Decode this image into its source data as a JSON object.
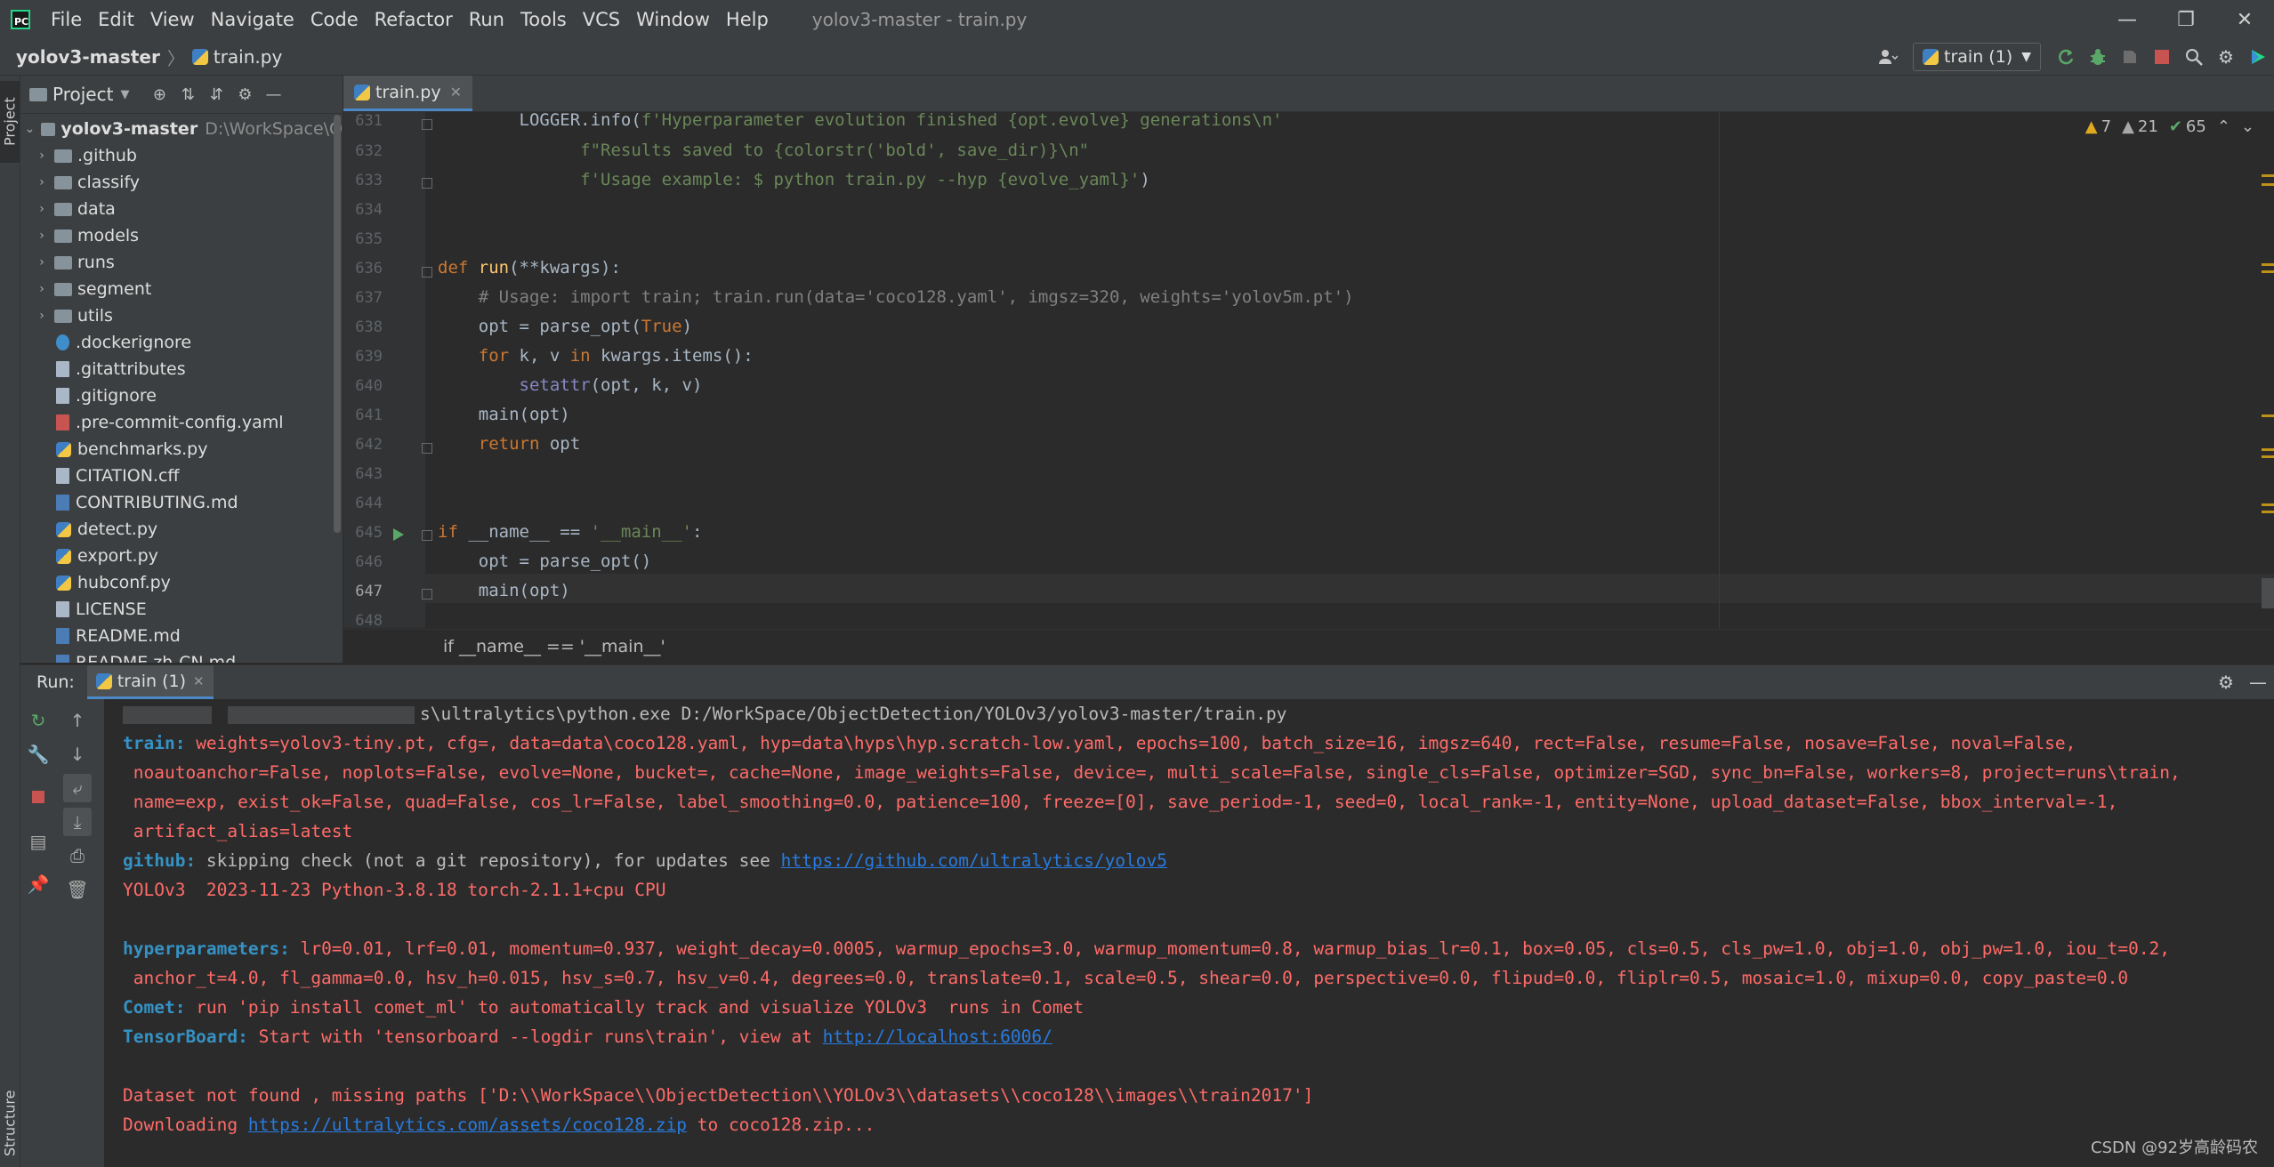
{
  "window": {
    "logo_text": "PC",
    "menu": [
      "File",
      "Edit",
      "View",
      "Navigate",
      "Code",
      "Refactor",
      "Run",
      "Tools",
      "VCS",
      "Window",
      "Help"
    ],
    "title": "yolov3-master - train.py",
    "controls": {
      "minimize": "—",
      "restore": "❐",
      "close": "✕"
    }
  },
  "navbar": {
    "project": "yolov3-master",
    "file": "train.py",
    "run_config": "train (1)"
  },
  "left_strip": {
    "project_tab": "Project",
    "structure_tab": "Structure"
  },
  "project_panel": {
    "title": "Project",
    "root": {
      "name": "yolov3-master",
      "path": "D:\\WorkSpace\\O"
    },
    "folders": [
      ".github",
      "classify",
      "data",
      "models",
      "runs",
      "segment",
      "utils"
    ],
    "files": [
      {
        "name": ".dockerignore",
        "kind": "docker"
      },
      {
        "name": ".gitattributes",
        "kind": "text"
      },
      {
        "name": ".gitignore",
        "kind": "text"
      },
      {
        "name": ".pre-commit-config.yaml",
        "kind": "yaml"
      },
      {
        "name": "benchmarks.py",
        "kind": "py"
      },
      {
        "name": "CITATION.cff",
        "kind": "text"
      },
      {
        "name": "CONTRIBUTING.md",
        "kind": "md"
      },
      {
        "name": "detect.py",
        "kind": "py"
      },
      {
        "name": "export.py",
        "kind": "py"
      },
      {
        "name": "hubconf.py",
        "kind": "py"
      },
      {
        "name": "LICENSE",
        "kind": "text"
      },
      {
        "name": "README.md",
        "kind": "md"
      },
      {
        "name": "README.zh-CN.md",
        "kind": "md"
      }
    ]
  },
  "editor": {
    "tab": "train.py",
    "inspections": {
      "warnings": "7",
      "weak_warnings": "21",
      "ok": "65"
    },
    "line_numbers": [
      "631",
      "632",
      "633",
      "634",
      "635",
      "636",
      "637",
      "638",
      "639",
      "640",
      "641",
      "642",
      "643",
      "644",
      "645",
      "646",
      "647",
      "648"
    ],
    "current_line": "647",
    "code": {
      "l631_a": "LOGGER.info(",
      "l631_b": "f'Hyperparameter evolution finished {opt.evolve} generations\\n'",
      "l632": "f\"Results saved to {colorstr('bold', save_dir)}\\n\"",
      "l633_a": "f'Usage example: $ python train.py --hyp {evolve_yaml}'",
      "l633_b": ")",
      "l636_kw": "def ",
      "l636_fn": "run",
      "l636_rest": "(**kwargs):",
      "l637": "# Usage: import train; train.run(data='coco128.yaml', imgsz=320, weights='yolov5m.pt')",
      "l638_a": "opt = parse_opt(",
      "l638_b": "True",
      "l638_c": ")",
      "l639_a": "for ",
      "l639_b": "k, v ",
      "l639_c": "in ",
      "l639_d": "kwargs.items():",
      "l640_a": "setattr",
      "l640_b": "(opt, k, v)",
      "l641": "main(opt)",
      "l642_a": "return ",
      "l642_b": "opt",
      "l645_a": "if ",
      "l645_b": "__name__",
      "l645_c": " == ",
      "l645_d": "'__main__'",
      "l645_e": ":",
      "l646": "opt = parse_opt()",
      "l647": "main(opt)"
    },
    "breadcrumb": "if __name__ == '__main__'"
  },
  "run_panel": {
    "label": "Run:",
    "tab": "train (1)",
    "console": {
      "cmd_tail": "s\\ultralytics\\python.exe D:/WorkSpace/ObjectDetection/YOLOv3/yolov3-master/train.py",
      "train_label": "train:",
      "train_1": " weights=yolov3-tiny.pt, cfg=, data=data\\coco128.yaml, hyp=data\\hyps\\hyp.scratch-low.yaml, epochs=100, batch_size=16, imgsz=640, rect=False, resume=False, nosave=False, noval=False,",
      "train_2": " noautoanchor=False, noplots=False, evolve=None, bucket=, cache=None, image_weights=False, device=, multi_scale=False, single_cls=False, optimizer=SGD, sync_bn=False, workers=8, project=runs\\train,",
      "train_3": " name=exp, exist_ok=False, quad=False, cos_lr=False, label_smoothing=0.0, patience=100, freeze=[0], save_period=-1, seed=0, local_rank=-1, entity=None, upload_dataset=False, bbox_interval=-1,",
      "train_4": " artifact_alias=latest",
      "github_label": "github:",
      "github_text": " skipping check (not a git repository), for updates see ",
      "github_link": "https://github.com/ultralytics/yolov5",
      "yolo_line": "YOLOv3  2023-11-23 Python-3.8.18 torch-2.1.1+cpu CPU",
      "hyp_label": "hyperparameters:",
      "hyp_1": " lr0=0.01, lrf=0.01, momentum=0.937, weight_decay=0.0005, warmup_epochs=3.0, warmup_momentum=0.8, warmup_bias_lr=0.1, box=0.05, cls=0.5, cls_pw=1.0, obj=1.0, obj_pw=1.0, iou_t=0.2,",
      "hyp_2": " anchor_t=4.0, fl_gamma=0.0, hsv_h=0.015, hsv_s=0.7, hsv_v=0.4, degrees=0.0, translate=0.1, scale=0.5, shear=0.0, perspective=0.0, flipud=0.0, fliplr=0.5, mosaic=1.0, mixup=0.0, copy_paste=0.0",
      "comet_label": "Comet:",
      "comet_text": " run 'pip install comet_ml' to automatically track and visualize YOLOv3  runs in Comet",
      "tb_label": "TensorBoard:",
      "tb_text": " Start with 'tensorboard --logdir runs\\train', view at ",
      "tb_link": "http://localhost:6006/",
      "dataset_line": "Dataset not found , missing paths ['D:\\\\WorkSpace\\\\ObjectDetection\\\\YOLOv3\\\\datasets\\\\coco128\\\\images\\\\train2017']",
      "dl_a": "Downloading ",
      "dl_link": "https://ultralytics.com/assets/coco128.zip",
      "dl_b": " to coco128.zip..."
    }
  },
  "watermark": "CSDN @92岁高龄码农"
}
